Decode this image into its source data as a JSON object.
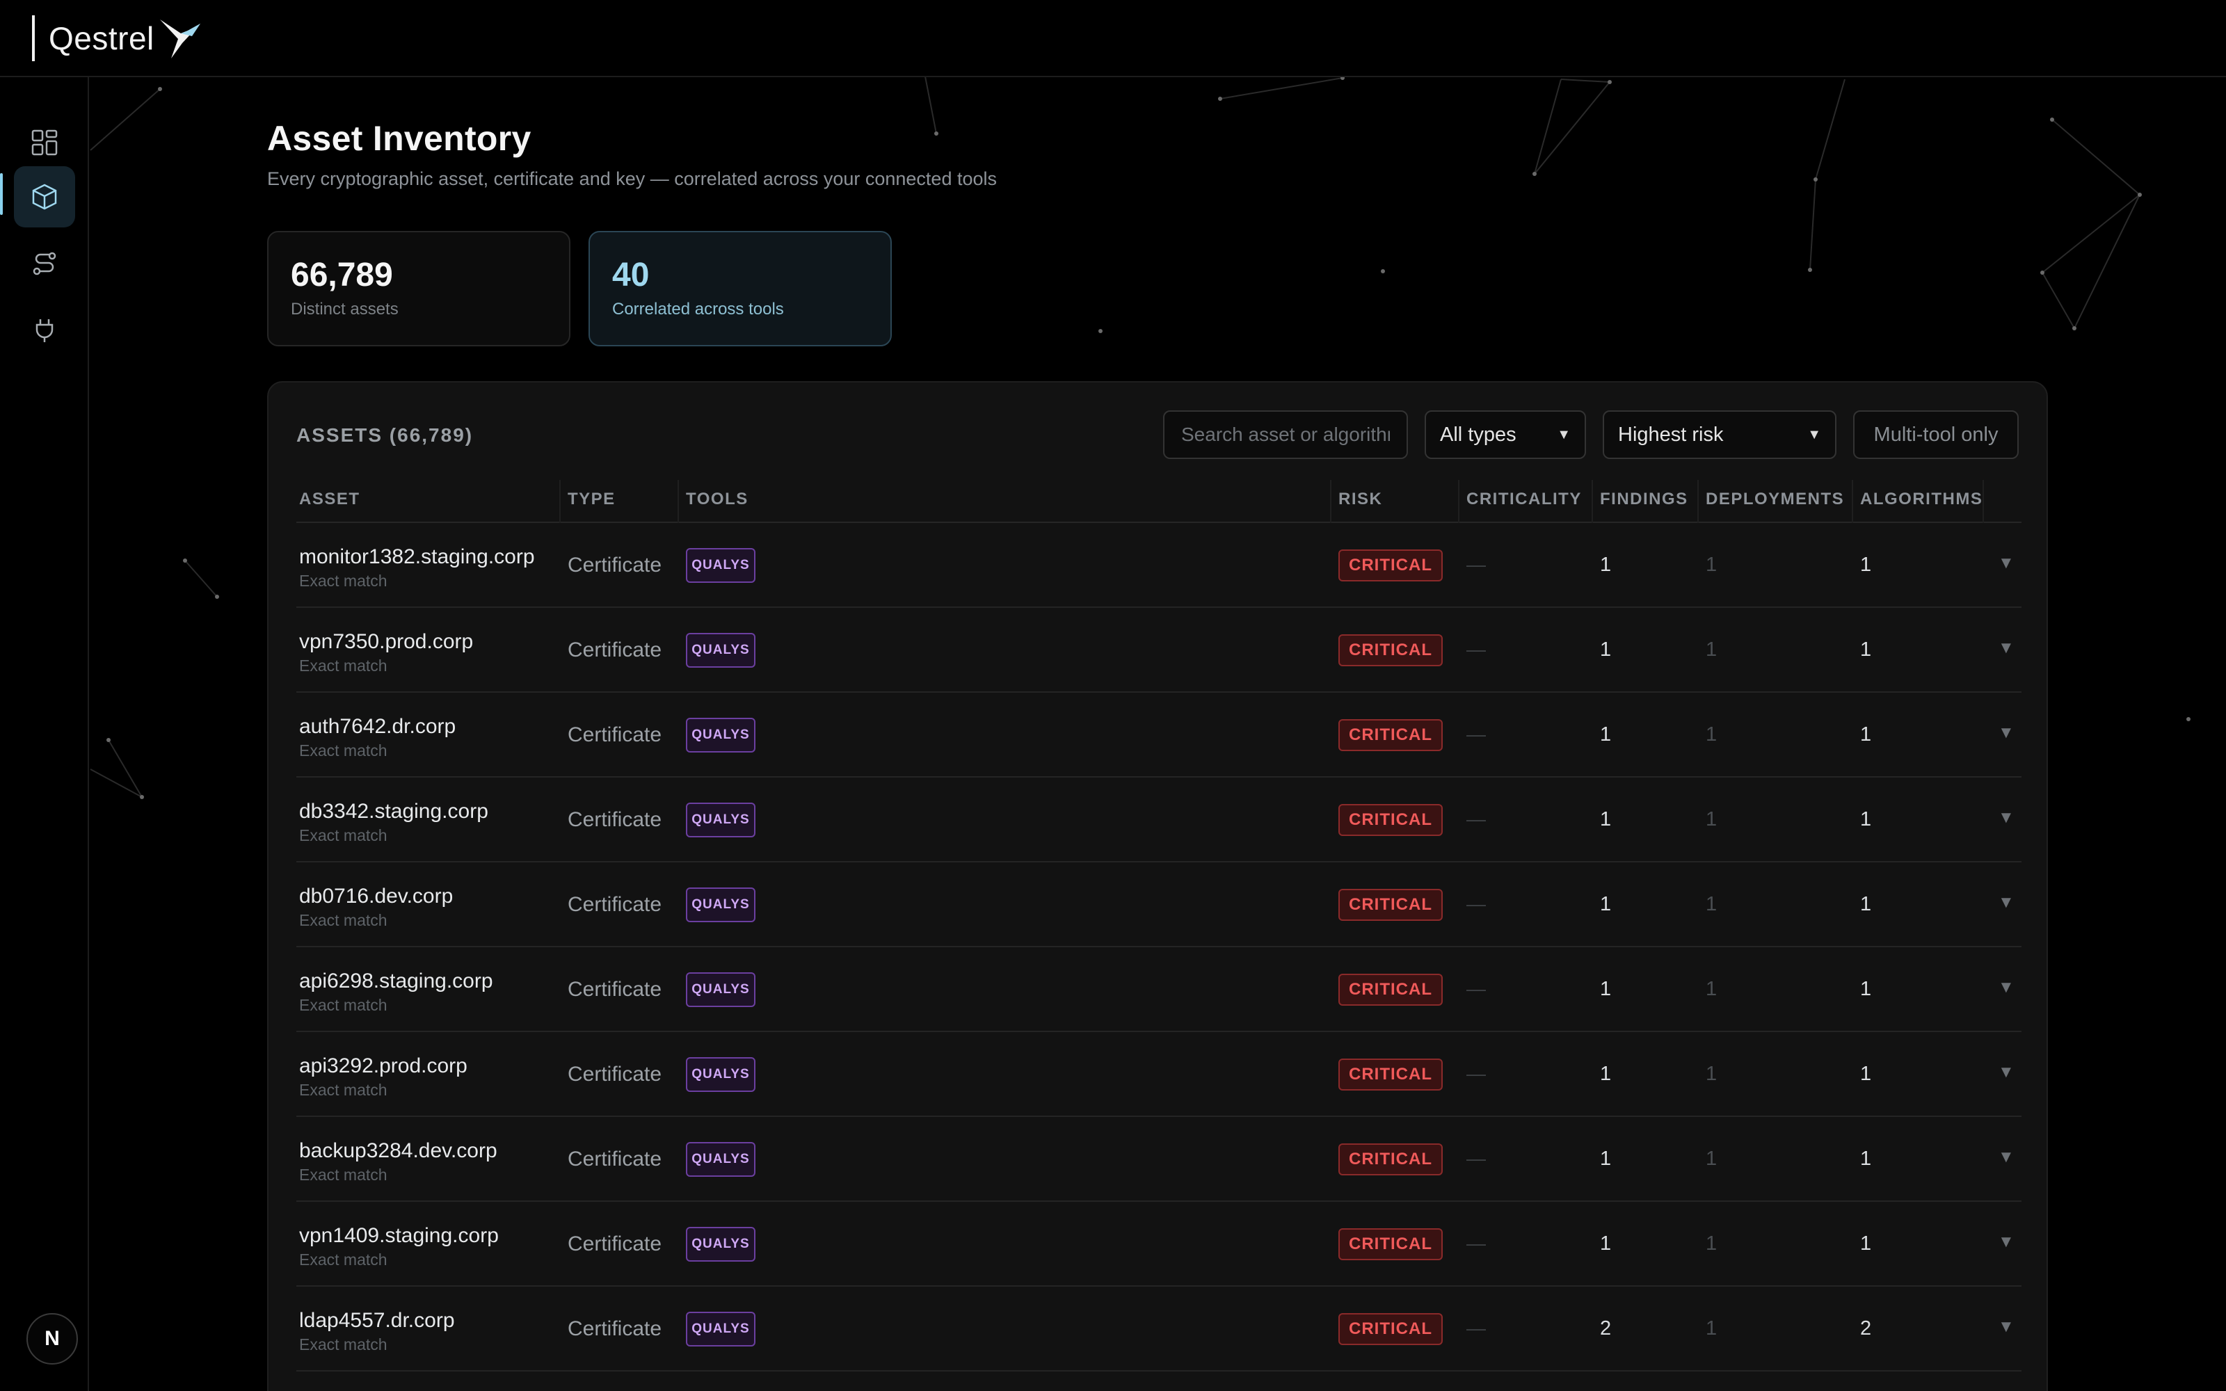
{
  "app": {
    "name": "Qestrel"
  },
  "sidebar": {
    "items": [
      {
        "name": "dashboard",
        "icon": "dashboard-grid-icon"
      },
      {
        "name": "assets",
        "icon": "cube-icon",
        "active": true
      },
      {
        "name": "workflows",
        "icon": "route-icon"
      },
      {
        "name": "integrations",
        "icon": "plug-icon"
      }
    ],
    "avatar_initial": "N"
  },
  "page": {
    "title": "Asset Inventory",
    "subtitle": "Every cryptographic asset, certificate and key — correlated across your connected tools"
  },
  "stats": [
    {
      "value": "66,789",
      "label": "Distinct assets"
    },
    {
      "value": "40",
      "label": "Correlated across tools"
    }
  ],
  "panel": {
    "title": "ASSETS (66,789)",
    "search_placeholder": "Search asset or algorithm",
    "type_filter": "All types",
    "sort": "Highest risk",
    "multi_tool_label": "Multi-tool only"
  },
  "columns": [
    "ASSET",
    "TYPE",
    "TOOLS",
    "RISK",
    "CRITICALITY",
    "FINDINGS",
    "DEPLOYMENTS",
    "ALGORITHMS"
  ],
  "rows": [
    {
      "asset": "monitor1382.staging.corp",
      "match": "Exact match",
      "type": "Certificate",
      "tool": "QUALYS",
      "risk": "CRITICAL",
      "criticality": "—",
      "findings": "1",
      "deployments": "1",
      "algorithms": "1"
    },
    {
      "asset": "vpn7350.prod.corp",
      "match": "Exact match",
      "type": "Certificate",
      "tool": "QUALYS",
      "risk": "CRITICAL",
      "criticality": "—",
      "findings": "1",
      "deployments": "1",
      "algorithms": "1"
    },
    {
      "asset": "auth7642.dr.corp",
      "match": "Exact match",
      "type": "Certificate",
      "tool": "QUALYS",
      "risk": "CRITICAL",
      "criticality": "—",
      "findings": "1",
      "deployments": "1",
      "algorithms": "1"
    },
    {
      "asset": "db3342.staging.corp",
      "match": "Exact match",
      "type": "Certificate",
      "tool": "QUALYS",
      "risk": "CRITICAL",
      "criticality": "—",
      "findings": "1",
      "deployments": "1",
      "algorithms": "1"
    },
    {
      "asset": "db0716.dev.corp",
      "match": "Exact match",
      "type": "Certificate",
      "tool": "QUALYS",
      "risk": "CRITICAL",
      "criticality": "—",
      "findings": "1",
      "deployments": "1",
      "algorithms": "1"
    },
    {
      "asset": "api6298.staging.corp",
      "match": "Exact match",
      "type": "Certificate",
      "tool": "QUALYS",
      "risk": "CRITICAL",
      "criticality": "—",
      "findings": "1",
      "deployments": "1",
      "algorithms": "1"
    },
    {
      "asset": "api3292.prod.corp",
      "match": "Exact match",
      "type": "Certificate",
      "tool": "QUALYS",
      "risk": "CRITICAL",
      "criticality": "—",
      "findings": "1",
      "deployments": "1",
      "algorithms": "1"
    },
    {
      "asset": "backup3284.dev.corp",
      "match": "Exact match",
      "type": "Certificate",
      "tool": "QUALYS",
      "risk": "CRITICAL",
      "criticality": "—",
      "findings": "1",
      "deployments": "1",
      "algorithms": "1"
    },
    {
      "asset": "vpn1409.staging.corp",
      "match": "Exact match",
      "type": "Certificate",
      "tool": "QUALYS",
      "risk": "CRITICAL",
      "criticality": "—",
      "findings": "1",
      "deployments": "1",
      "algorithms": "1"
    },
    {
      "asset": "ldap4557.dr.corp",
      "match": "Exact match",
      "type": "Certificate",
      "tool": "QUALYS",
      "risk": "CRITICAL",
      "criticality": "—",
      "findings": "2",
      "deployments": "1",
      "algorithms": "2"
    }
  ],
  "colors": {
    "accent": "#8ad2ee",
    "critical": "#f05a5a",
    "tool_badge": "#cfa8f5",
    "background": "#000000"
  }
}
